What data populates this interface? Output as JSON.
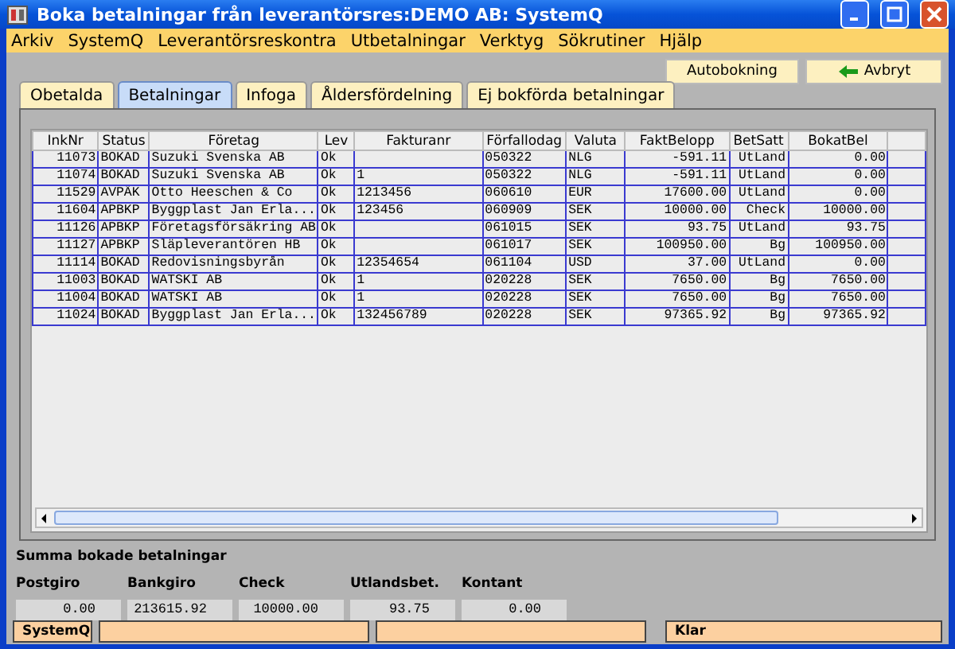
{
  "window": {
    "title": "Boka betalningar från leverantörsres:DEMO AB: SystemQ"
  },
  "menu": [
    "Arkiv",
    "SystemQ",
    "Leverantörsreskontra",
    "Utbetalningar",
    "Verktyg",
    "Sökrutiner",
    "Hjälp"
  ],
  "toolbar": [
    {
      "label": "Autobokning",
      "kind": "plain"
    },
    {
      "label": "Avbryt",
      "kind": "back"
    }
  ],
  "tabs": [
    {
      "label": "Obetalda",
      "selected": false
    },
    {
      "label": "Betalningar",
      "selected": true
    },
    {
      "label": "Infoga",
      "selected": false
    },
    {
      "label": "Åldersfördelning",
      "selected": false
    },
    {
      "label": "Ej bokförda betalningar",
      "selected": false
    }
  ],
  "table": {
    "columns": [
      "InkNr",
      "Status",
      "Företag",
      "Lev",
      "Fakturanr",
      "Förfallodag",
      "Valuta",
      "FaktBelopp",
      "BetSatt",
      "BokatBel"
    ],
    "rows": [
      [
        "11073",
        "BOKAD",
        "Suzuki Svenska AB",
        "Ok",
        "",
        "050322",
        "NLG",
        "-591.11",
        "UtLand",
        "0.00"
      ],
      [
        "11074",
        "BOKAD",
        "Suzuki Svenska AB",
        "Ok",
        "1",
        "050322",
        "NLG",
        "-591.11",
        "UtLand",
        "0.00"
      ],
      [
        "11529",
        "AVPÄK",
        "Otto Heeschen & Co",
        "Ok",
        "1213456",
        "060610",
        "EUR",
        "17600.00",
        "UtLand",
        "0.00"
      ],
      [
        "11604",
        "APBKP",
        "Byggplast Jan Erla...",
        "Ok",
        "123456",
        "060909",
        "SEK",
        "10000.00",
        "Check",
        "10000.00"
      ],
      [
        "11126",
        "APBKP",
        "Företagsförsäkring AB",
        "Ok",
        "",
        "061015",
        "SEK",
        "93.75",
        "UtLand",
        "93.75"
      ],
      [
        "11127",
        "APBKP",
        "Släpleverantören HB",
        "Ok",
        "",
        "061017",
        "SEK",
        "100950.00",
        "Bg",
        "100950.00"
      ],
      [
        "11114",
        "BOKAD",
        "Redovisningsbyrån",
        "Ok",
        "12354654",
        "061104",
        "USD",
        "37.00",
        "UtLand",
        "0.00"
      ],
      [
        "11003",
        "BOKAD",
        "WATSKI AB",
        "Ok",
        "1",
        "020228",
        "SEK",
        "7650.00",
        "Bg",
        "7650.00"
      ],
      [
        "11004",
        "BOKAD",
        "WATSKI AB",
        "Ok",
        "1",
        "020228",
        "SEK",
        "7650.00",
        "Bg",
        "7650.00"
      ],
      [
        "11024",
        "BOKAD",
        "Byggplast Jan Erla...",
        "Ok",
        "132456789",
        "020228",
        "SEK",
        "97365.92",
        "Bg",
        "97365.92"
      ]
    ]
  },
  "summary": {
    "title": "Summa bokade betalningar",
    "fields": [
      {
        "label": "Postgiro",
        "value": "0.00"
      },
      {
        "label": "Bankgiro",
        "value": "213615.92"
      },
      {
        "label": "Check",
        "value": "10000.00"
      },
      {
        "label": "Utlandsbet.",
        "value": "93.75"
      },
      {
        "label": "Kontant",
        "value": "0.00"
      }
    ]
  },
  "status_bar": {
    "left": "SystemQ",
    "right": "Klar"
  }
}
